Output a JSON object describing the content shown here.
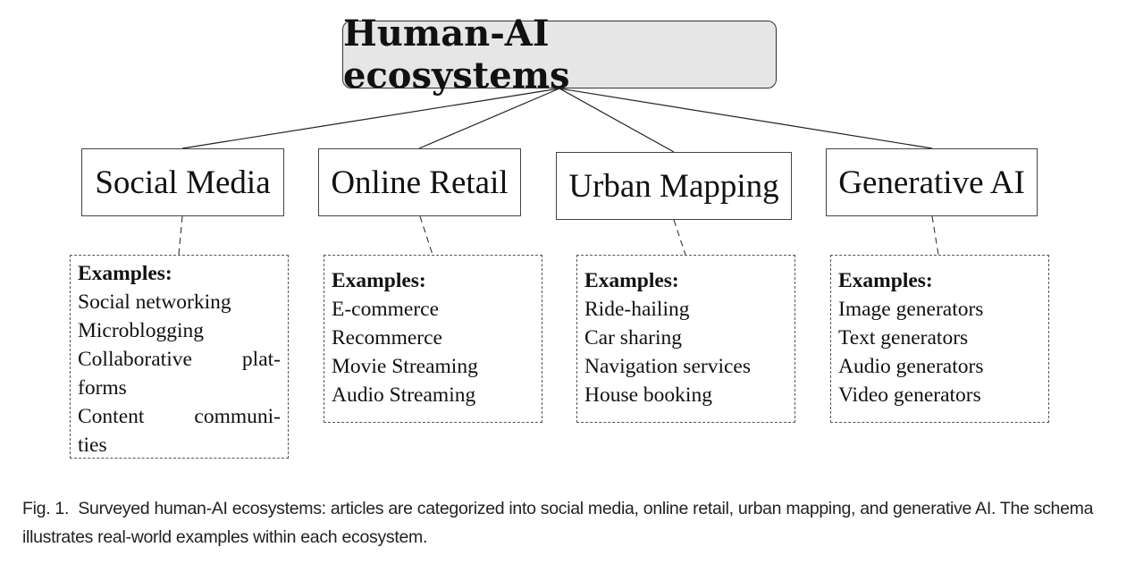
{
  "root": {
    "title": "Human-AI ecosystems"
  },
  "categories": [
    {
      "label": "Social Media",
      "examples_title": "Examples:",
      "examples": [
        "Social networking",
        "Microblogging",
        "Collaborative plat-",
        "forms",
        "Content communi-",
        "ties"
      ]
    },
    {
      "label": "Online Retail",
      "examples_title": "Examples:",
      "examples": [
        "E-commerce",
        "Recommerce",
        "Movie Streaming",
        "Audio Streaming"
      ]
    },
    {
      "label": "Urban Mapping",
      "examples_title": "Examples:",
      "examples": [
        "Ride-hailing",
        "Car sharing",
        "Navigation services",
        "House booking"
      ]
    },
    {
      "label": "Generative AI",
      "examples_title": "Examples:",
      "examples": [
        "Image generators",
        "Text generators",
        "Audio generators",
        "Video generators"
      ]
    }
  ],
  "caption": {
    "label": "Fig. 1.",
    "text": "Surveyed human-AI ecosystems: articles are categorized into social media, online retail, urban mapping, and generative AI. The schema illustrates real-world examples within each ecosystem."
  },
  "colors": {
    "root_fill": "#e6e6e6",
    "stroke": "#333333"
  }
}
